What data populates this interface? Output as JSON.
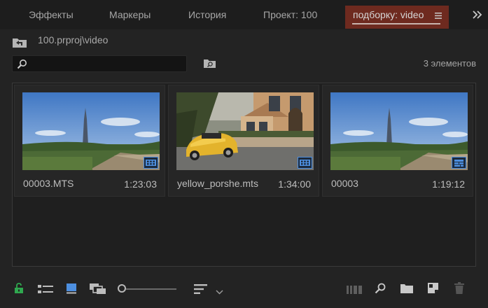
{
  "tabs": [
    {
      "label": "Эффекты",
      "active": false
    },
    {
      "label": "Маркеры",
      "active": false
    },
    {
      "label": "История",
      "active": false
    },
    {
      "label": "Проект: 100",
      "active": false
    },
    {
      "label": "подборку: video",
      "active": true
    }
  ],
  "overflow_icon": "double-chevron-right-icon",
  "tab_menu_icon": "hamburger-menu-icon",
  "path": {
    "text": "100.prproj\\video",
    "icon": "navigate-up-folder-icon"
  },
  "search": {
    "placeholder": "",
    "value": "",
    "icon": "magnifier-icon"
  },
  "item_count": "3 элементов",
  "items": [
    {
      "name": "00003.MTS",
      "duration": "1:23:03",
      "badge": "video-clip-icon"
    },
    {
      "name": "yellow_porshe.mts",
      "duration": "1:34:00",
      "badge": "video-clip-icon"
    },
    {
      "name": "00003",
      "duration": "1:19:12",
      "badge": "sequence-icon"
    }
  ],
  "colors": {
    "active_tab_bg": "#6e2a1f",
    "lock_green": "#2fa84f",
    "accent_blue": "#4d8fe0"
  },
  "toolbar": {
    "icons": [
      "lock-open-icon",
      "list-view-icon",
      "icon-view-icon",
      "freeform-view-icon",
      "zoom-slider",
      "sort-icons-icon",
      "automate-to-sequence-icon",
      "find-icon",
      "new-bin-icon",
      "new-item-icon",
      "clear-trash-icon"
    ]
  }
}
